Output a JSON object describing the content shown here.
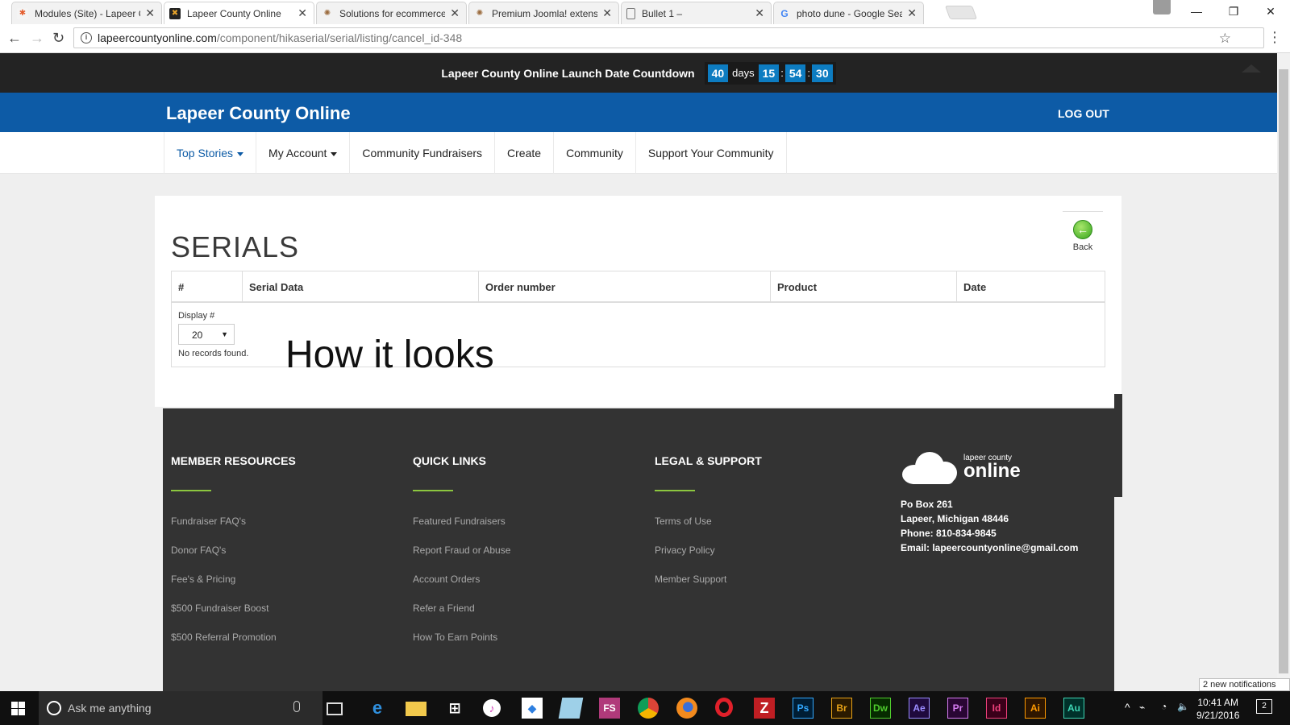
{
  "browser": {
    "tabs": [
      {
        "title": "Modules (Site) - Lapeer C",
        "favicon": "joomla-icon"
      },
      {
        "title": "Lapeer County Online",
        "favicon": "site-icon"
      },
      {
        "title": "Solutions for ecommerce",
        "favicon": "hikashop-icon"
      },
      {
        "title": "Premium Joomla! extensi",
        "favicon": "hikashop-icon"
      },
      {
        "title": "Bullet 1 –",
        "favicon": "document-icon"
      },
      {
        "title": "photo dune - Google Sea",
        "favicon": "google-icon"
      }
    ],
    "url_host": "lapeercountyonline.com",
    "url_path": "/component/hikaserial/serial/listing/cancel_id-348"
  },
  "countdown": {
    "label": "Lapeer County Online Launch Date Countdown",
    "days": "40",
    "days_unit": "days",
    "hours": "15",
    "minutes": "54",
    "seconds": "30"
  },
  "header": {
    "site_title": "Lapeer County Online",
    "logout": "LOG OUT",
    "brand_color": "#0d5ba6"
  },
  "nav": {
    "items": [
      {
        "label": "Top Stories"
      },
      {
        "label": "My Account"
      },
      {
        "label": "Community Fundraisers"
      },
      {
        "label": "Create"
      },
      {
        "label": "Community"
      },
      {
        "label": "Support Your Community"
      }
    ]
  },
  "main": {
    "title": "SERIALS",
    "back_label": "Back",
    "columns": [
      "#",
      "Serial Data",
      "Order number",
      "Product",
      "Date"
    ],
    "display_label": "Display #",
    "display_value": "20",
    "no_records": "No records found.",
    "annotation": "How it looks"
  },
  "footer": {
    "col1": {
      "heading": "MEMBER RESOURCES",
      "links": [
        "Fundraiser FAQ's",
        "Donor FAQ's",
        "Fee's & Pricing",
        "$500 Fundraiser Boost",
        "$500 Referral Promotion"
      ]
    },
    "col2": {
      "heading": "QUICK LINKS",
      "links": [
        "Featured Fundraisers",
        "Report Fraud or Abuse",
        "Account Orders",
        "Refer a Friend",
        "How To Earn Points"
      ]
    },
    "col3": {
      "heading": "LEGAL & SUPPORT",
      "links": [
        "Terms of Use",
        "Privacy Policy",
        "Member Support"
      ]
    },
    "logo_small": "lapeer county",
    "logo_big": "online",
    "address1": "Po Box 261",
    "address2": "Lapeer, Michigan 48446",
    "phone": "Phone: 810-834-9845",
    "email": "Email: lapeercountyonline@gmail.com",
    "accent_color": "#8cc63f"
  },
  "taskbar": {
    "search_placeholder": "Ask me anything",
    "notifications": "2 new notifications",
    "time": "10:41 AM",
    "date": "9/21/2016",
    "action_center_count": "2",
    "apps": [
      "task-view-icon",
      "edge-icon",
      "file-explorer-icon",
      "store-icon",
      "itunes-icon",
      "dropbox-icon",
      "notepad-icon",
      "fs-icon",
      "chrome-icon",
      "firefox-icon",
      "opera-icon",
      "filezilla-icon",
      "photoshop-icon",
      "bridge-icon",
      "dreamweaver-icon",
      "after-effects-icon",
      "premiere-icon",
      "indesign-icon",
      "illustrator-icon",
      "audition-icon"
    ],
    "app_labels": {
      "fs": "FS",
      "ps": "Ps",
      "br": "Br",
      "dw": "Dw",
      "ae": "Ae",
      "pr": "Pr",
      "id": "Id",
      "ai": "Ai",
      "au": "Au"
    }
  }
}
